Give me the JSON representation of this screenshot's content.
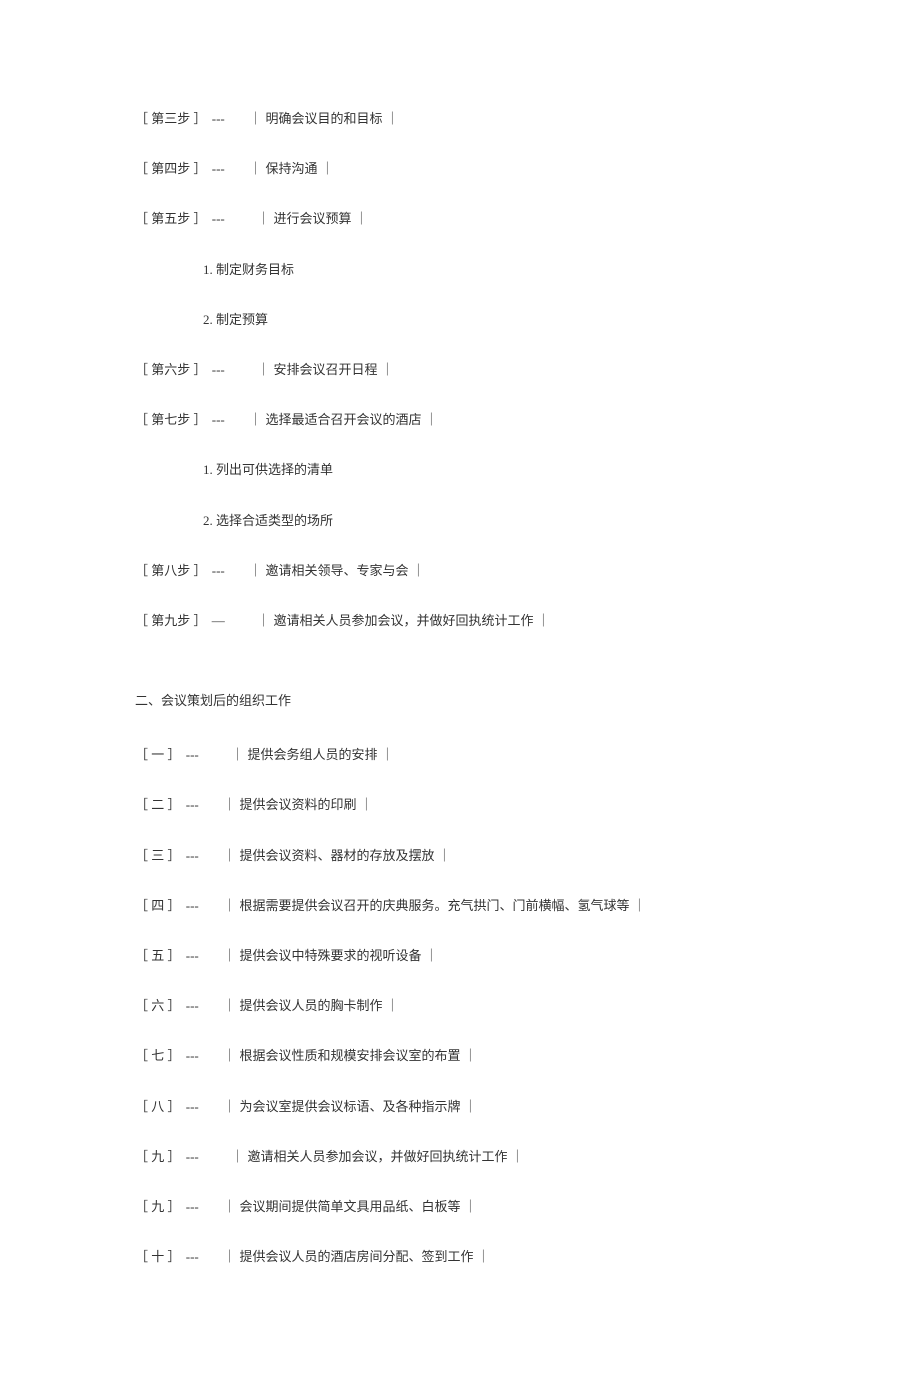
{
  "section1": {
    "steps": [
      {
        "label": "［ 第三步 ］",
        "text": "｜ 明确会议目的和目标 ｜",
        "gap": "small",
        "subitems": []
      },
      {
        "label": "［ 第四步 ］",
        "text": "｜ 保持沟通 ｜",
        "gap": "small",
        "subitems": []
      },
      {
        "label": "［ 第五步 ］",
        "text": "｜ 进行会议预算 ｜",
        "gap": "mid",
        "subitems": [
          "1.  制定财务目标",
          "2.  制定预算"
        ]
      },
      {
        "label": "［ 第六步 ］",
        "text": "｜ 安排会议召开日程 ｜",
        "gap": "mid",
        "subitems": []
      },
      {
        "label": "［ 第七步 ］",
        "text": "｜ 选择最适合召开会议的酒店 ｜",
        "gap": "small",
        "subitems": [
          "1.  列出可供选择的清单",
          "2.  选择合适类型的场所"
        ]
      },
      {
        "label": "［ 第八步 ］",
        "text": "｜ 邀请相关领导、专家与会 ｜",
        "gap": "small",
        "subitems": []
      },
      {
        "label": "［ 第九步 ］",
        "text": "｜ 邀请相关人员参加会议，并做好回执统计工作 ｜",
        "gap": "mid",
        "subitems": []
      }
    ]
  },
  "section2": {
    "heading": "二、会议策划后的组织工作",
    "items": [
      {
        "label": "［ 一 ］",
        "text": "｜ 提供会务组人员的安排 ｜",
        "gap": "mid"
      },
      {
        "label": "［ 二 ］",
        "text": "｜ 提供会议资料的印刷 ｜",
        "gap": "small"
      },
      {
        "label": "［ 三 ］",
        "text": "｜ 提供会议资料、器材的存放及摆放 ｜",
        "gap": "small"
      },
      {
        "label": "［ 四 ］",
        "text": "｜ 根据需要提供会议召开的庆典服务。充气拱门、门前横幅、氢气球等 ｜",
        "gap": "small"
      },
      {
        "label": "［ 五 ］",
        "text": "｜ 提供会议中特殊要求的视听设备 ｜",
        "gap": "small"
      },
      {
        "label": "［ 六 ］",
        "text": "｜ 提供会议人员的胸卡制作 ｜",
        "gap": "small"
      },
      {
        "label": "［ 七 ］",
        "text": "｜ 根据会议性质和规模安排会议室的布置 ｜",
        "gap": "small"
      },
      {
        "label": "［ 八 ］",
        "text": "｜ 为会议室提供会议标语、及各种指示牌 ｜",
        "gap": "small"
      },
      {
        "label": "［ 九 ］",
        "text": "｜ 邀请相关人员参加会议，并做好回执统计工作 ｜",
        "gap": "mid"
      },
      {
        "label": "［ 九 ］",
        "text": "｜ 会议期间提供简单文具用品纸、白板等 ｜",
        "gap": "small"
      },
      {
        "label": "［ 十 ］",
        "text": "｜ 提供会议人员的酒店房间分配、签到工作 ｜",
        "gap": "small"
      }
    ]
  }
}
